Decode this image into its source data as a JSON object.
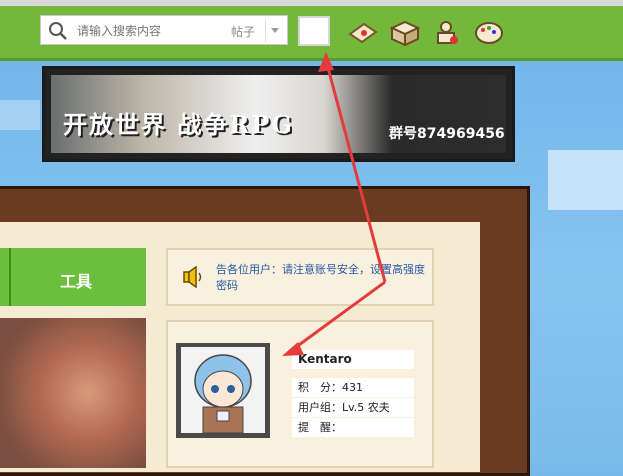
{
  "search": {
    "placeholder": "请输入搜索内容",
    "type": "帖子"
  },
  "toolbar_icons": [
    "envelope-icon",
    "cube-icon",
    "user-icon",
    "palette-icon"
  ],
  "banner": {
    "title": "开放世界 战争RPG",
    "group": "群号874969456"
  },
  "tabs": [
    {
      "label": "工具"
    }
  ],
  "notice": {
    "text": "告各位用户：请注意账号安全，设置高强度密码"
  },
  "profile": {
    "username": "Kentaro",
    "points_label": "积　分：",
    "points": "431",
    "group_label": "用户组：",
    "group": "Lv.5 农夫",
    "reminder_label": "提　醒："
  },
  "colors": {
    "topbar": "#73b83a",
    "tab": "#6abf3c",
    "notice_text": "#2557a7",
    "book": "#6b3a20",
    "arrow": "#e53b3b"
  }
}
